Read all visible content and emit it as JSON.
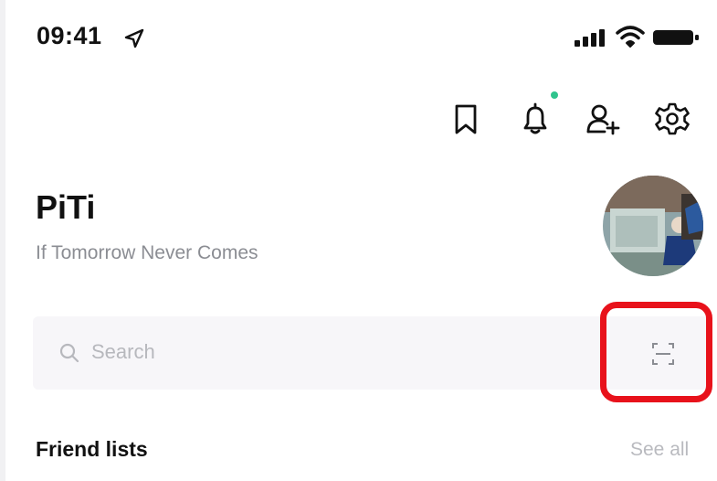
{
  "status_bar": {
    "time": "09:41",
    "icons": [
      "location-arrow-icon",
      "cellular-signal-icon",
      "wifi-icon",
      "battery-icon"
    ]
  },
  "toolbar": {
    "icons": [
      "bookmark-icon",
      "notification-bell-icon",
      "add-friend-icon",
      "settings-gear-icon"
    ],
    "notification_dot_color": "#2fc48d"
  },
  "profile": {
    "name": "PiTi",
    "status_message": "If Tomorrow Never Comes"
  },
  "search": {
    "placeholder": "Search",
    "scan_icon": "qr-scan-icon"
  },
  "highlight": {
    "color": "#e8121b"
  },
  "friends_section": {
    "title": "Friend lists",
    "see_all_label": "See all"
  }
}
